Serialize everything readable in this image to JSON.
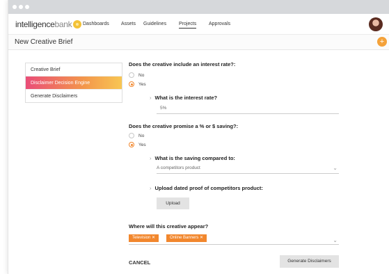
{
  "app": {
    "logo_part1": "intelligence",
    "logo_part2": "bank"
  },
  "nav": {
    "items": [
      "Dashboards",
      "Assets",
      "Guidelines",
      "Projects",
      "Approvals"
    ],
    "active": "Projects"
  },
  "page": {
    "title": "New Creative Brief",
    "add_button": "+"
  },
  "sidebar": {
    "items": [
      {
        "label": "Creative Brief",
        "active": false
      },
      {
        "label": "Disclaimer Decision Engine",
        "active": true
      },
      {
        "label": "Generate Disclaimers",
        "active": false
      }
    ]
  },
  "form": {
    "q1": {
      "label": "Does the creative include an interest rate?:",
      "options": [
        "No",
        "Yes"
      ],
      "selected": "Yes",
      "sub_label": "What is the interest rate?",
      "sub_value": "5%"
    },
    "q2": {
      "label": "Does the creative promise a % or $ saving?:",
      "options": [
        "No",
        "Yes"
      ],
      "selected": "Yes",
      "sub_label": "What is the saving compared to:",
      "sub_value": "A competitors product",
      "upload_label": "Upload dated proof of competitors product:",
      "upload_button": "Upload"
    },
    "q3": {
      "label": "Where will this creative appear?",
      "tags": [
        "Television",
        "Online Banners"
      ]
    },
    "cancel": "CANCEL",
    "submit": "Generate Disclaimers"
  },
  "colors": {
    "accent": "#f2872d",
    "gradient_start": "#ea4d78",
    "gradient_end": "#f8c653"
  }
}
